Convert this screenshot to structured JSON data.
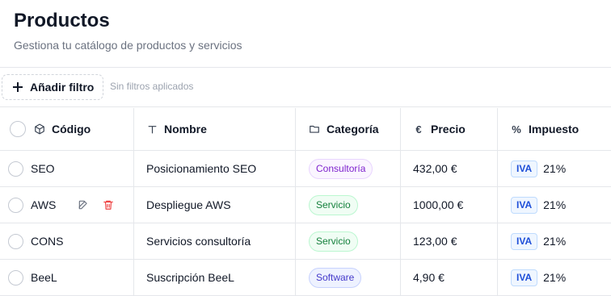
{
  "header": {
    "title": "Productos",
    "subtitle": "Gestiona tu catálogo de productos y servicios"
  },
  "filters": {
    "add_label": "Añadir filtro",
    "status": "Sin filtros aplicados"
  },
  "columns": {
    "code": "Código",
    "name": "Nombre",
    "category": "Categoría",
    "price": "Precio",
    "tax": "Impuesto"
  },
  "rows": [
    {
      "code": "SEO",
      "name": "Posicionamiento SEO",
      "category": "Consultoría",
      "category_color": "#7e22ce",
      "price": "432,00 €",
      "tax_type": "IVA",
      "tax_rate": "21%"
    },
    {
      "code": "AWS",
      "name": "Despliegue AWS",
      "category": "Servicio",
      "category_color": "#15803d",
      "price": "1000,00 €",
      "tax_type": "IVA",
      "tax_rate": "21%"
    },
    {
      "code": "CONS",
      "name": "Servicios consultoría",
      "category": "Servicio",
      "category_color": "#15803d",
      "price": "123,00 €",
      "tax_type": "IVA",
      "tax_rate": "21%"
    },
    {
      "code": "BeeL",
      "name": "Suscripción BeeL",
      "category": "Software",
      "category_color": "#4338ca",
      "price": "4,90 €",
      "tax_type": "IVA",
      "tax_rate": "21%"
    }
  ],
  "hovered_row_actions": [
    "edit-icon",
    "trash-icon"
  ],
  "colors": {
    "delete": "#ef4444",
    "edit": "#6b7280"
  }
}
